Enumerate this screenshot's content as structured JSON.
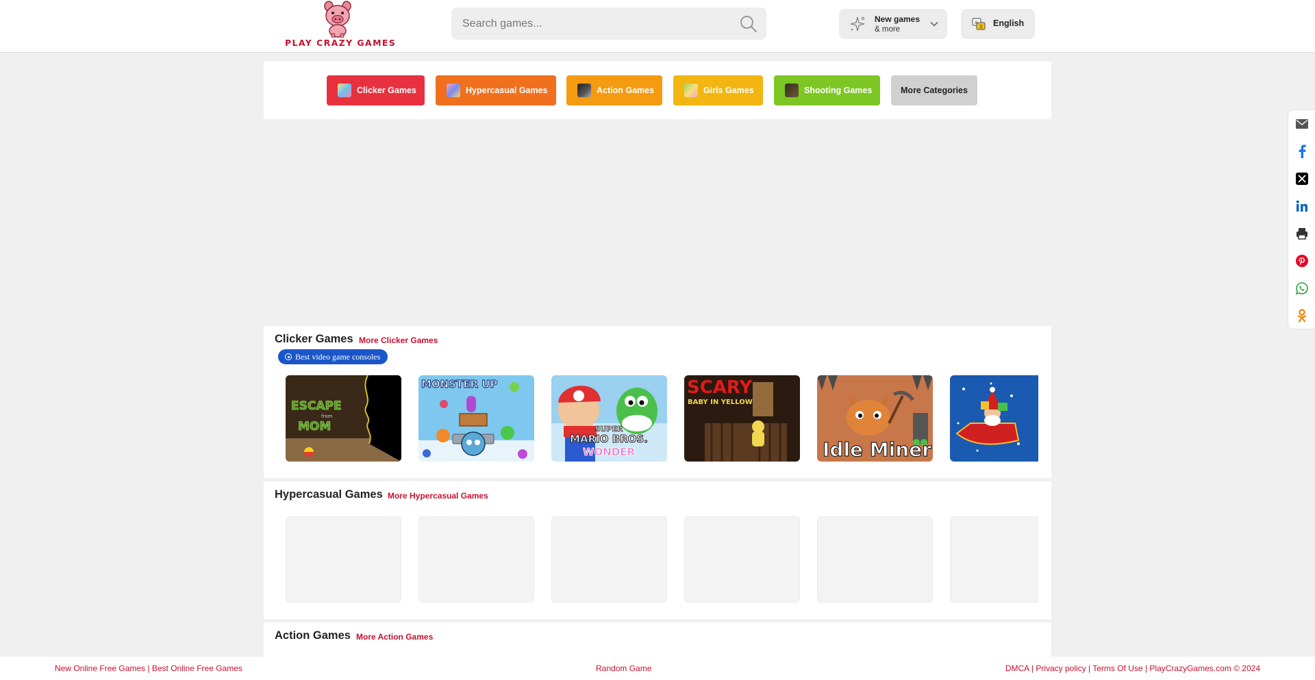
{
  "header": {
    "logo_text": "PLAY CRAZY GAMES",
    "search": {
      "placeholder": "Search games..."
    },
    "new_games": {
      "title": "New games",
      "subtitle": "& more"
    },
    "language": {
      "label": "English"
    }
  },
  "categories": [
    {
      "label": "Clicker Games",
      "color": "#e8313e"
    },
    {
      "label": "Hypercasual Games",
      "color": "#f0701e"
    },
    {
      "label": "Action Games",
      "color": "#f59b12"
    },
    {
      "label": "Girls Games",
      "color": "#f2b511"
    },
    {
      "label": "Shooting Games",
      "color": "#7dc724"
    },
    {
      "label": "More Categories",
      "color": "#d0d0d0"
    }
  ],
  "sections": {
    "clicker": {
      "title": "Clicker Games",
      "more": "More Clicker Games",
      "ad_pill": "Best video game consoles",
      "thumbs": [
        "escape-mom-thumb",
        "monster-up-thumb",
        "super-mario-wonder-thumb",
        "scary-baby-yellow-thumb",
        "idle-miner-thumb",
        "santa-sleigh-thumb"
      ],
      "thumb_text": {
        "escape": "ESCAPE",
        "from": "from",
        "mom": "MOM",
        "monster_up": "MONSTER UP",
        "super": "SUPER",
        "mario_bros": "MARIO BROS.",
        "wonder": "WONDER",
        "scary": "SCARY",
        "baby_in_yellow": "BABY IN YELLOW",
        "idle_miner": "Idle Miner"
      }
    },
    "hypercasual": {
      "title": "Hypercasual Games",
      "more": "More Hypercasual Games"
    },
    "action": {
      "title": "Action Games",
      "more": "More Action Games"
    }
  },
  "share": [
    "email-icon",
    "facebook-icon",
    "x-icon",
    "linkedin-icon",
    "print-icon",
    "pinterest-icon",
    "whatsapp-icon",
    "odnoklassniki-icon"
  ],
  "footer": {
    "left_link_1": "New Online Free Games",
    "left_sep": "|",
    "left_link_2": "Best Online Free Games",
    "random": "Random Game",
    "dmca": "DMCA",
    "privacy": "Privacy policy",
    "terms": "Terms Of Use",
    "copyright": "PlayCrazyGames.com © 2024",
    "sep": "|"
  }
}
